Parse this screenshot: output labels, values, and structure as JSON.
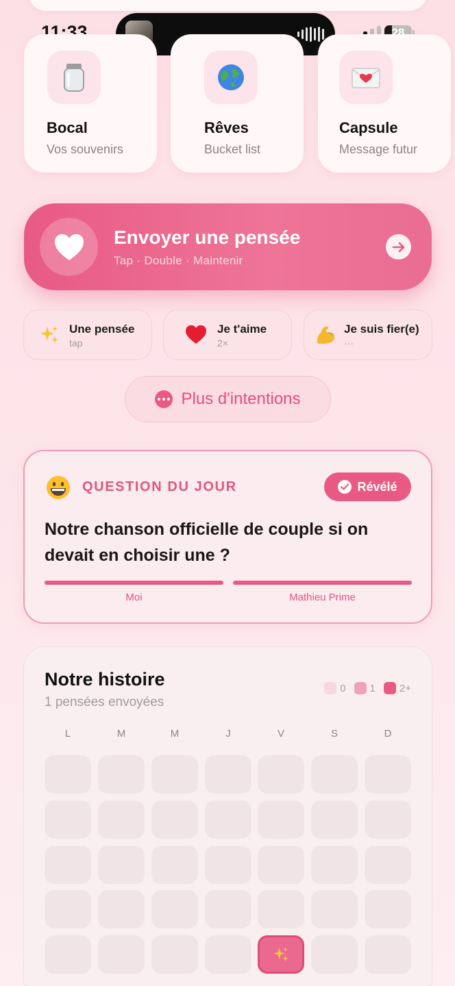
{
  "status_bar": {
    "time": "11:33",
    "battery": "28",
    "battery_level": 0.28
  },
  "tiles": [
    {
      "title": "Bocal",
      "subtitle": "Vos souvenirs",
      "icon": "jar-icon"
    },
    {
      "title": "Rêves",
      "subtitle": "Bucket list",
      "icon": "globe-icon"
    },
    {
      "title": "Capsule",
      "subtitle": "Message futur",
      "icon": "love-letter-icon"
    }
  ],
  "hero": {
    "title": "Envoyer une pensée",
    "subtitle": "Tap · Double · Maintenir",
    "icon": "heart-icon",
    "arrow_icon": "arrow-right-icon"
  },
  "intentions": [
    {
      "title": "Une pensée",
      "subtitle": "tap",
      "icon": "sparkles-icon"
    },
    {
      "title": "Je t'aime",
      "subtitle": "2×",
      "icon": "red-heart-icon"
    },
    {
      "title": "Je suis fier(e)",
      "subtitle": "···",
      "icon": "flexed-biceps-icon"
    }
  ],
  "more_button": {
    "label": "Plus d'intentions",
    "icon": "ellipsis-circle-icon"
  },
  "question": {
    "label": "QUESTION DU JOUR",
    "emoji": "grinning-face-icon",
    "badge": "Révélé",
    "text": "Notre chanson officielle de couple si on devait en choisir une ?",
    "participants": [
      {
        "name": "Moi",
        "progress": 1.0
      },
      {
        "name": "Mathieu Prime",
        "progress": 1.0
      }
    ]
  },
  "history": {
    "title": "Notre histoire",
    "subtitle": "1 pensées envoyées",
    "legend": [
      {
        "label": "0",
        "color": "#f6d8df"
      },
      {
        "label": "1",
        "color": "#f0a3b8"
      },
      {
        "label": "2+",
        "color": "#e85a84"
      }
    ],
    "weekdays": [
      "L",
      "M",
      "M",
      "J",
      "V",
      "S",
      "D"
    ],
    "active_cell": {
      "row": 4,
      "col": 4,
      "icon": "sparkles-icon"
    }
  },
  "colors": {
    "accent": "#e85a84",
    "accent_text": "#e35580",
    "background": "#fde3e8"
  }
}
